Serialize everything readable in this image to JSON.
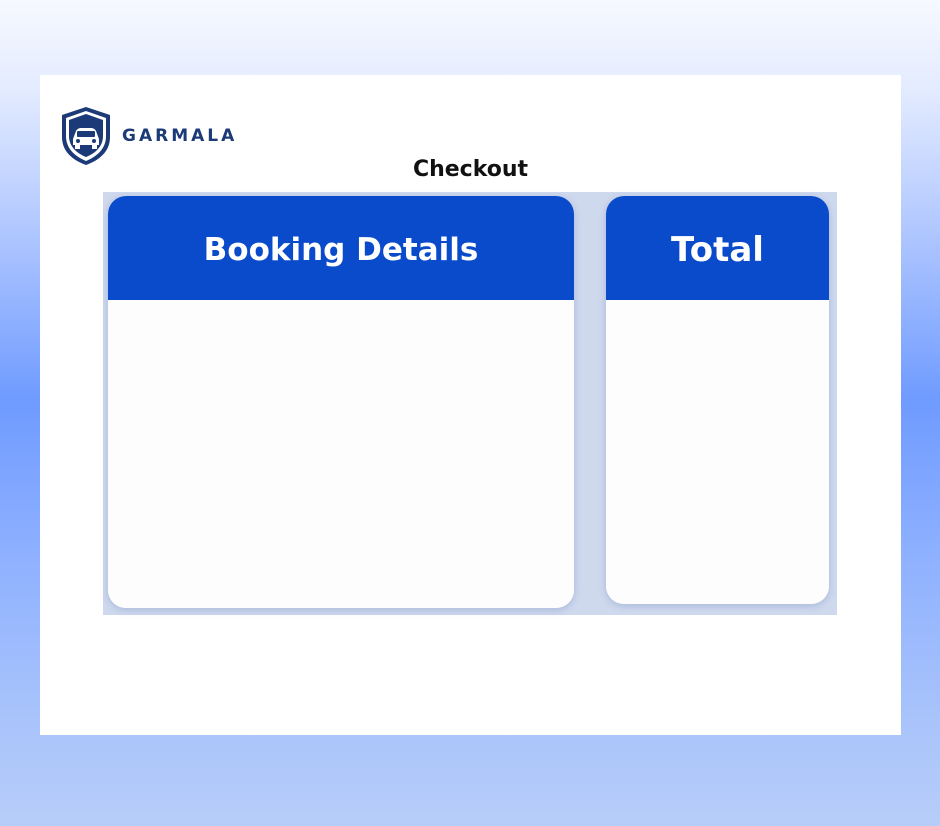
{
  "brand": {
    "name": "GARMALA",
    "icon": "car-shield-logo-icon"
  },
  "page": {
    "title": "Checkout"
  },
  "panels": {
    "booking_details": {
      "title": "Booking Details"
    },
    "total": {
      "title": "Total"
    }
  },
  "colors": {
    "primary": "#0a4bcb",
    "brand_text": "#1c3a78",
    "card": "#ffffff",
    "panel_area": "#cfd9ee"
  }
}
